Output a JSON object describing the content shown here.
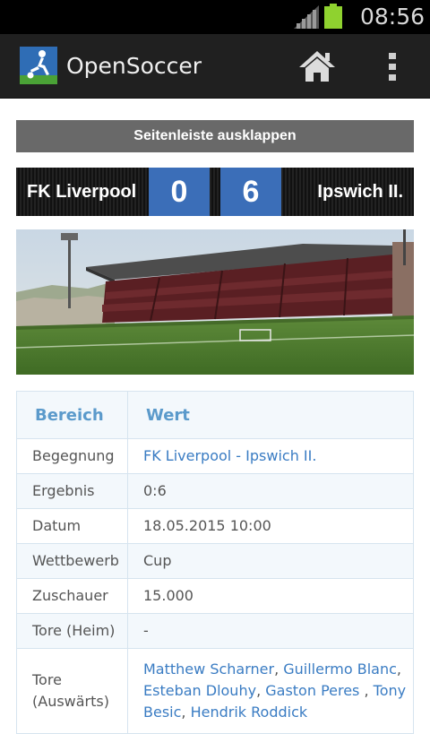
{
  "status_bar": {
    "time": "08:56",
    "battery_color": "#8fd22f",
    "icons": [
      "signal-icon",
      "battery-icon"
    ]
  },
  "action_bar": {
    "title": "OpenSoccer",
    "icons": [
      "app-logo-icon",
      "home-icon",
      "overflow-menu-icon"
    ]
  },
  "sidebar_toggle": {
    "label": "Seitenleiste ausklappen"
  },
  "scoreboard": {
    "home_team": "FK Liverpool",
    "away_team": "Ipswich II.",
    "home_score": "0",
    "away_score": "6",
    "score_color": "#3b6eb8"
  },
  "table": {
    "headers": {
      "key": "Bereich",
      "value": "Wert"
    },
    "rows": [
      {
        "key": "Begegnung",
        "value": "FK Liverpool - Ipswich II."
      },
      {
        "key": "Ergebnis",
        "value": "0:6"
      },
      {
        "key": "Datum",
        "value": "18.05.2015 10:00"
      },
      {
        "key": "Wettbewerb",
        "value": "Cup"
      },
      {
        "key": "Zuschauer",
        "value": "15.000"
      },
      {
        "key": "Tore (Heim)",
        "value": "-"
      },
      {
        "key": "Tore (Auswärts)",
        "scorers": [
          {
            "name": "Matthew Scharner",
            "sep": ", "
          },
          {
            "name": "Guillermo Blanc",
            "sep": ", "
          },
          {
            "name": "Esteban Dlouhy",
            "sep": ", "
          },
          {
            "name": "Gaston Peres ",
            "sep": ", "
          },
          {
            "name": "Tony Besic",
            "sep": ", "
          },
          {
            "name": "Hendrik Roddick",
            "sep": ""
          }
        ]
      }
    ]
  },
  "colors": {
    "link": "#3a7cc3",
    "header_text": "#5b9acb",
    "button_bg": "#696969",
    "action_bar_bg": "#202020"
  }
}
